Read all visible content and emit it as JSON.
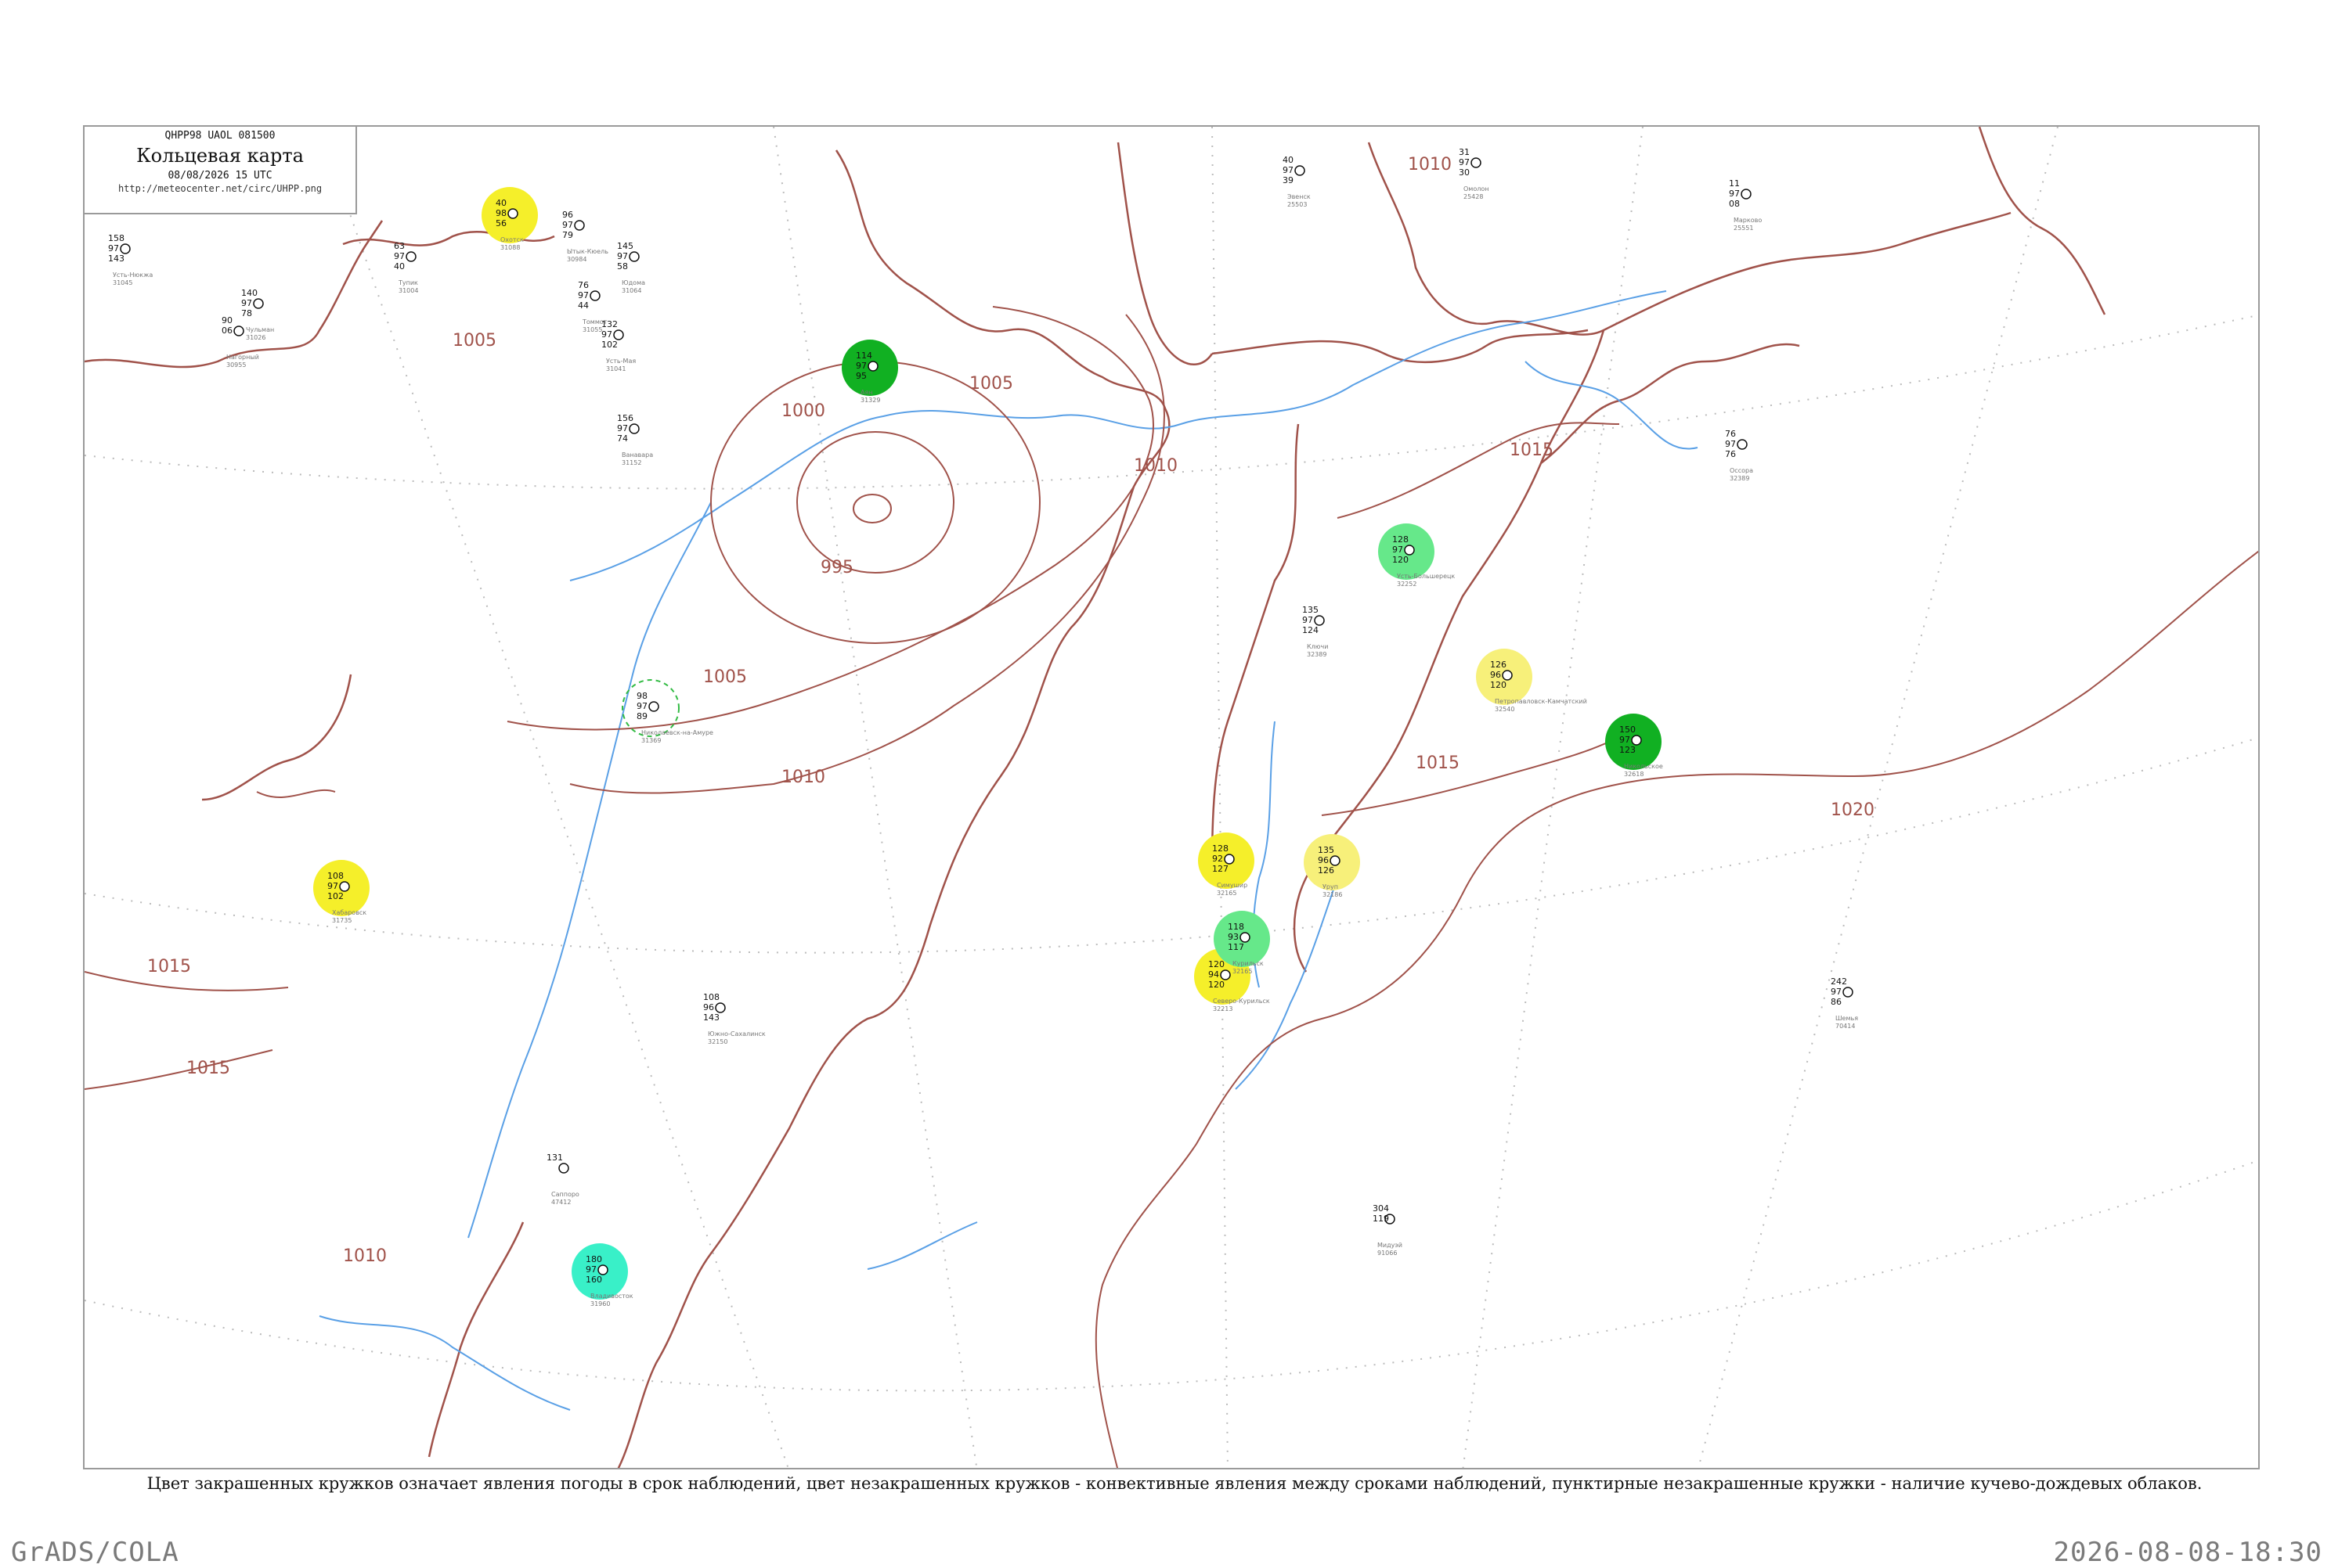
{
  "header": {
    "code": "QHPP98  UAOL  081500",
    "title": "Кольцевая карта",
    "date": "08/08/2026 15 UTC",
    "url": "http://meteocenter.net/circ/UHPP.png"
  },
  "caption": "Цвет закрашенных кружков означает явления погоды в срок наблюдений, цвет незакрашенных кружков - конвективные явления между сроками наблюдений, пунктирные незакрашенные кружки - наличие кучево-дождевых облаков.",
  "footer": {
    "software": "GrADS/COLA",
    "timestamp": "2026-08-08-18:30"
  },
  "colors": {
    "isobar": "#a0524a",
    "coast": "#a0524a",
    "river": "#5aa0e6",
    "dark_green": "#11b022",
    "light_green": "#66e88a",
    "yellow": "#f5ef2a",
    "pale_yellow": "#f7f07a",
    "cyan": "#39f0c8",
    "dashed_green": "#33bb44"
  },
  "isobar_labels": [
    "1005",
    "1000",
    "995",
    "1005",
    "1010",
    "1005",
    "1010",
    "1015",
    "1015",
    "1020",
    "1010",
    "1015",
    "1015",
    "1010"
  ],
  "stations": [
    {
      "name": "Усть-Нюкжа",
      "num": "31045",
      "values": [
        "158",
        "97",
        "143"
      ],
      "symbol": "none"
    },
    {
      "name": "Тупик",
      "num": "31004",
      "values": [
        "63",
        "97",
        "40"
      ],
      "symbol": "none"
    },
    {
      "name": "Чульман",
      "num": "31026",
      "values": [
        "140",
        "97",
        "78"
      ],
      "symbol": "none"
    },
    {
      "name": "Нагорный",
      "num": "30955",
      "values": [
        "90",
        "06"
      ],
      "symbol": "none"
    },
    {
      "name": "Ытык-Кюель",
      "num": "30984",
      "values": [
        "96",
        "97",
        "79"
      ],
      "symbol": "none"
    },
    {
      "name": "Томмот",
      "num": "31055",
      "values": [
        "76",
        "97",
        "44"
      ],
      "symbol": "none"
    },
    {
      "name": "Усть-Мая",
      "num": "31041",
      "values": [
        "132",
        "97",
        "102"
      ],
      "symbol": "none"
    },
    {
      "name": "Юдома",
      "num": "31064",
      "values": [
        "145",
        "97",
        "58"
      ],
      "symbol": "none"
    },
    {
      "name": "Ванавара",
      "num": "31152",
      "values": [
        "156",
        "97",
        "74"
      ],
      "symbol": "none"
    },
    {
      "name": "Петропавловск-Камчатский",
      "num": "32540",
      "values": [
        "126",
        "96",
        "120"
      ],
      "symbol": "pale_yellow"
    },
    {
      "name": "Ключи",
      "num": "32389",
      "values": [
        "135",
        "97",
        "124"
      ],
      "symbol": "none"
    },
    {
      "name": "Охотск",
      "num": "31088",
      "values": [
        "40",
        "98",
        "56"
      ],
      "symbol": "yellow"
    },
    {
      "name": "Аян",
      "num": "31329",
      "values": [
        "114",
        "97",
        "95"
      ],
      "symbol": "dark_green"
    },
    {
      "name": "Николаевск-на-Амуре",
      "num": "31369",
      "values": [
        "98",
        "97",
        "89"
      ],
      "symbol": "dashed_green"
    },
    {
      "name": "Хабаровск",
      "num": "31735",
      "values": [
        "108",
        "97",
        "102"
      ],
      "symbol": "yellow"
    },
    {
      "name": "Южно-Сахалинск",
      "num": "32150",
      "values": [
        "108",
        "96",
        "143"
      ],
      "symbol": "none"
    },
    {
      "name": "Северо-Курильск",
      "num": "32213",
      "values": [
        "120",
        "94",
        "120"
      ],
      "symbol": "yellow"
    },
    {
      "name": "Курильск",
      "num": "32165",
      "values": [
        "118",
        "93",
        "117"
      ],
      "symbol": "light_green"
    },
    {
      "name": "Усть-Большерецк",
      "num": "32252",
      "values": [
        "128",
        "97",
        "120"
      ],
      "symbol": "light_green"
    },
    {
      "name": "Никольское",
      "num": "32618",
      "values": [
        "150",
        "97",
        "123"
      ],
      "symbol": "dark_green"
    },
    {
      "name": "Владивосток",
      "num": "31960",
      "values": [
        "180",
        "97",
        "160"
      ],
      "symbol": "cyan"
    },
    {
      "name": "Саппоро",
      "num": "47412",
      "values": [
        "131"
      ],
      "symbol": "none"
    },
    {
      "name": "Марковo",
      "num": "25551",
      "values": [
        "11",
        "97",
        "08"
      ],
      "symbol": "none"
    },
    {
      "name": "Омолон",
      "num": "25428",
      "values": [
        "31",
        "97",
        "30"
      ],
      "symbol": "none"
    },
    {
      "name": "Эвенск",
      "num": "25503",
      "values": [
        "40",
        "97",
        "39"
      ],
      "symbol": "none"
    },
    {
      "name": "Оссора",
      "num": "32389",
      "values": [
        "76",
        "97",
        "76"
      ],
      "symbol": "none"
    },
    {
      "name": "Шемья",
      "num": "70414",
      "values": [
        "242",
        "97",
        "86"
      ],
      "symbol": "none"
    },
    {
      "name": "Мидуэй",
      "num": "91066",
      "values": [
        "304",
        "119"
      ],
      "symbol": "none"
    },
    {
      "name": "Симушир",
      "num": "32165",
      "values": [
        "128",
        "92",
        "127"
      ],
      "symbol": "yellow"
    },
    {
      "name": "Уруп",
      "num": "32186",
      "values": [
        "135",
        "96",
        "126"
      ],
      "symbol": "pale_yellow"
    }
  ]
}
